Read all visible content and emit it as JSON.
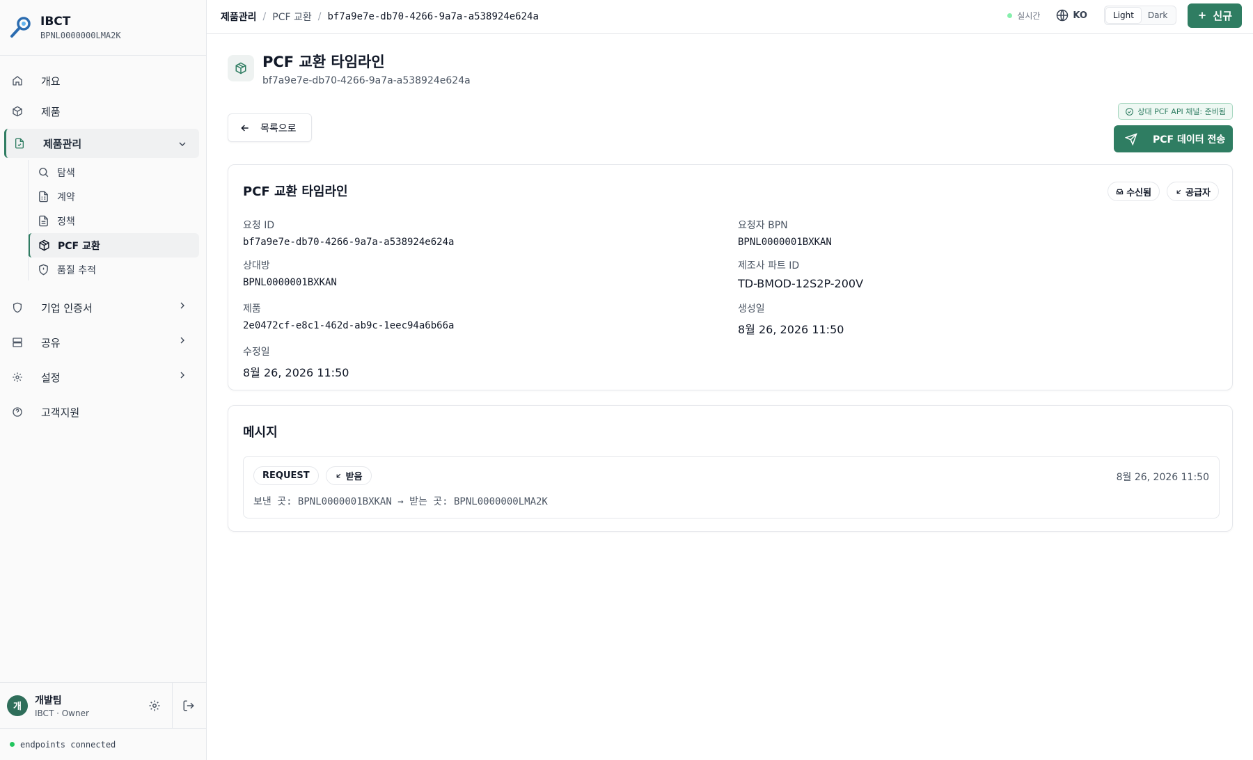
{
  "brand": {
    "title": "IBCT",
    "bpn": "BPNL0000000LMA2K"
  },
  "sidebar": {
    "items": [
      {
        "label": "개요",
        "icon": "home-icon"
      },
      {
        "label": "제품",
        "icon": "box-icon"
      },
      {
        "label": "제품관리",
        "icon": "file-check-icon"
      },
      {
        "label": "기업 인증서",
        "icon": "shield-icon"
      },
      {
        "label": "공유",
        "icon": "server-icon"
      },
      {
        "label": "설정",
        "icon": "gear-icon"
      },
      {
        "label": "고객지원",
        "icon": "help-circle-icon"
      }
    ],
    "sub_items": [
      {
        "label": "탐색",
        "icon": "search-icon"
      },
      {
        "label": "계약",
        "icon": "contract-icon"
      },
      {
        "label": "정책",
        "icon": "document-icon"
      },
      {
        "label": "PCF 교환",
        "icon": "package-icon"
      },
      {
        "label": "품질 추적",
        "icon": "shield-alert-icon"
      }
    ]
  },
  "user": {
    "initial": "개",
    "name": "개발팀",
    "role": "IBCT · Owner"
  },
  "connection": {
    "status": "endpoints connected"
  },
  "breadcrumb": [
    "제품관리",
    "PCF 교환",
    "bf7a9e7e-db70-4266-9a7a-a538924e624a"
  ],
  "topbar": {
    "live_label": "실시간",
    "lang": "KO",
    "theme_light": "Light",
    "theme_dark": "Dark",
    "new_label": "신규"
  },
  "header": {
    "title": "PCF 교환 타임라인",
    "subtitle": "bf7a9e7e-db70-4266-9a7a-a538924e624a"
  },
  "actions": {
    "back_label": "목록으로",
    "api_status": "상대 PCF API 채널: 준비됨",
    "send_label": "PCF 데이터 전송"
  },
  "timeline": {
    "title": "PCF 교환 타임라인",
    "chips": [
      "수신됨",
      "공급자"
    ],
    "fields": {
      "request_id": {
        "label": "요청 ID",
        "value": "bf7a9e7e-db70-4266-9a7a-a538924e624a"
      },
      "requester_bpn": {
        "label": "요청자 BPN",
        "value": "BPNL0000001BXKAN"
      },
      "counterparty": {
        "label": "상대방",
        "value": "BPNL0000001BXKAN"
      },
      "manufacturer_part_id": {
        "label": "제조사 파트 ID",
        "value": "TD-BMOD-12S2P-200V"
      },
      "product": {
        "label": "제품",
        "value": "2e0472cf-e8c1-462d-ab9c-1eec94a6b66a"
      },
      "created": {
        "label": "생성일",
        "value": "8월 26, 2026 11:50"
      },
      "modified": {
        "label": "수정일",
        "value": "8월 26, 2026 11:50"
      }
    }
  },
  "messages": {
    "title": "메시지",
    "items": [
      {
        "type": "REQUEST",
        "direction": "받음",
        "timestamp": "8월 26, 2026 11:50",
        "route": "보낸 곳: BPNL0000001BXKAN → 받는 곳: BPNL0000000LMA2K"
      }
    ]
  },
  "colors": {
    "accent": "#2f7d62",
    "border": "#e5e7eb"
  }
}
